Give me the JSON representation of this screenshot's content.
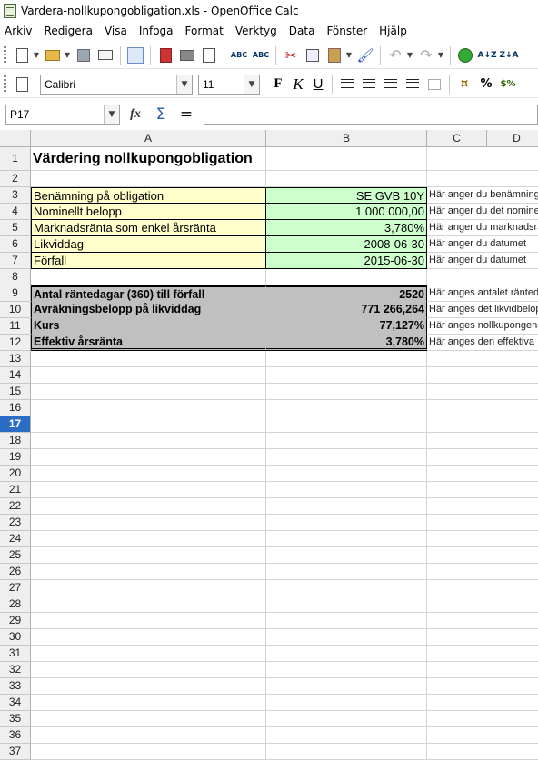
{
  "window": {
    "title": "Vardera-nollkupongobligation.xls - OpenOffice Calc"
  },
  "menu": [
    "Arkiv",
    "Redigera",
    "Visa",
    "Infoga",
    "Format",
    "Verktyg",
    "Data",
    "Fönster",
    "Hjälp"
  ],
  "format_toolbar": {
    "font_name": "Calibri",
    "font_size": "11",
    "bold": "F",
    "italic": "K",
    "underline": "U"
  },
  "formula_bar": {
    "cell_reference": "P17",
    "formula": "",
    "fx": "fx",
    "sum": "Σ",
    "equals": "="
  },
  "columns": [
    "A",
    "B",
    "C",
    "D"
  ],
  "active_row": "17",
  "rows": [
    {
      "num": "1",
      "a": "Värdering nollkupongobligation",
      "b": "",
      "c": ""
    },
    {
      "num": "2",
      "a": "",
      "b": "",
      "c": ""
    },
    {
      "num": "3",
      "a": "Benämning på obligation",
      "b": "SE GVB 10Y",
      "c": "Här anger du benämning"
    },
    {
      "num": "4",
      "a": "Nominellt belopp",
      "b": "1 000 000,00",
      "c": "Här anger du det nominella"
    },
    {
      "num": "5",
      "a": "Marknadsränta som enkel årsränta",
      "b": "3,780%",
      "c": "Här anger du marknadsräntan"
    },
    {
      "num": "6",
      "a": "Likviddag",
      "b": "2008-06-30",
      "c": "Här anger du datumet"
    },
    {
      "num": "7",
      "a": "Förfall",
      "b": "2015-06-30",
      "c": "Här anger du datumet"
    },
    {
      "num": "8",
      "a": "",
      "b": "",
      "c": ""
    },
    {
      "num": "9",
      "a": "Antal räntedagar (360) till förfall",
      "b": "2520",
      "c": "Här anges antalet räntedagar"
    },
    {
      "num": "10",
      "a": "Avräkningsbelopp på likviddag",
      "b": "771 266,264",
      "c": "Här anges det likvidbelopp"
    },
    {
      "num": "11",
      "a": "Kurs",
      "b": "77,127%",
      "c": "Här anges nollkupongens kurs"
    },
    {
      "num": "12",
      "a": "Effektiv årsränta",
      "b": "3,780%",
      "c": "Här anges den effektiva"
    }
  ],
  "empty_rows": [
    "13",
    "14",
    "15",
    "16",
    "17",
    "18",
    "19",
    "20",
    "21",
    "22",
    "23",
    "24",
    "25",
    "26",
    "27",
    "28",
    "29",
    "30",
    "31",
    "32",
    "33",
    "34",
    "35",
    "36",
    "37"
  ],
  "colors": {
    "input_label_bg": "#ffffcc",
    "input_value_bg": "#ccffcc",
    "calc_bg": "#c0c0c0",
    "active_row_bg": "#2b6cc4"
  }
}
